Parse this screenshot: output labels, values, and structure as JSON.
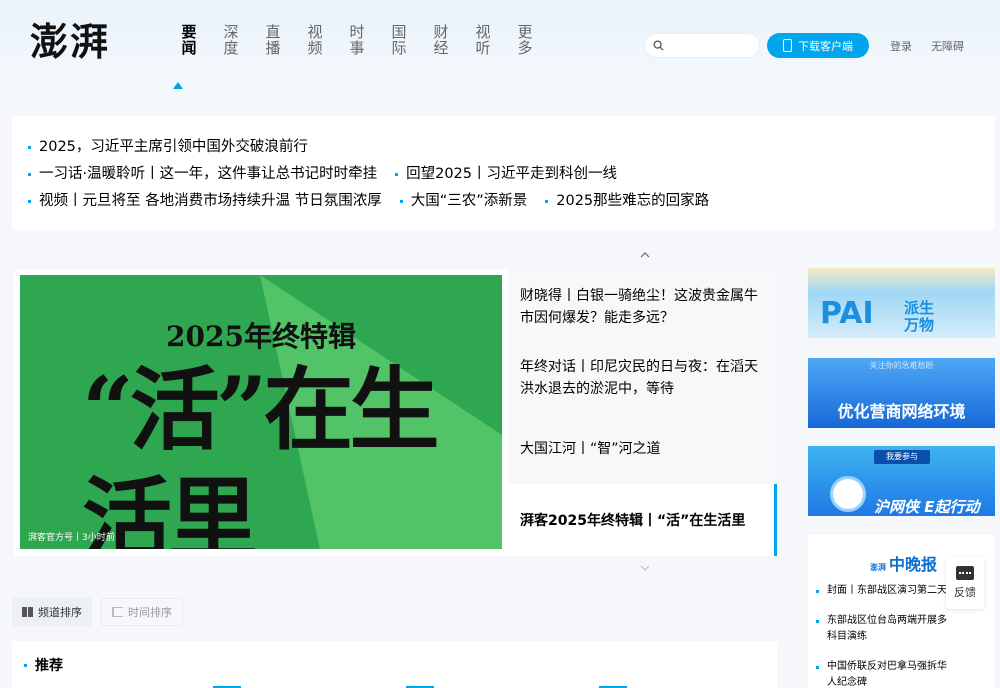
{
  "header": {
    "logo": "澎湃",
    "nav": [
      {
        "line1": "要",
        "line2": "闻"
      },
      {
        "line1": "深",
        "line2": "度"
      },
      {
        "line1": "直",
        "line2": "播"
      },
      {
        "line1": "视",
        "line2": "频"
      },
      {
        "line1": "时",
        "line2": "事"
      },
      {
        "line1": "国",
        "line2": "际"
      },
      {
        "line1": "财",
        "line2": "经"
      },
      {
        "line1": "视",
        "line2": "听"
      },
      {
        "line1": "更",
        "line2": "多"
      }
    ],
    "search_placeholder": "",
    "download_label": "下载客户端",
    "login_label": "登录",
    "accessibility_label": "无障碍"
  },
  "headlines": {
    "line1": [
      "2025，习近平主席引领中国外交破浪前行"
    ],
    "line2": [
      "一习话·温暖聆听丨这一年，这件事让总书记时时牵挂",
      "回望2025丨习近平走到科创一线"
    ],
    "line3": [
      "视频丨元旦将至 各地消费市场持续升温 节日氛围浓厚",
      "大国“三农”添新景",
      "2025那些难忘的回家路"
    ]
  },
  "focus": {
    "poster_sub": "2025年终特辑",
    "poster_main": "“活”在生活里",
    "poster_source": "湃客官方号丨3小时前",
    "items": [
      "财晓得丨白银一骑绝尘！这波贵金属牛市因何爆发？能走多远？",
      "年终对话丨印尼灾民的日与夜：在滔天洪水退去的淤泥中，等待",
      "大国江河丨“智”河之道",
      "湃客2025年终特辑丨“活”在生活里"
    ]
  },
  "ads": {
    "ad1_main": "PAI",
    "ad1_sub1": "派生",
    "ad1_sub2": "万物",
    "ad2_top": "关注你的急难愁盼",
    "ad2_main": "优化营商网络环境",
    "ad3_btn": "我要参与",
    "ad3_main": "沪网侠 E起行动"
  },
  "evening": {
    "logo_small": "澎湃",
    "logo": "中晚报",
    "items": [
      "封面丨东部战区演习第二天",
      "东部战区位台岛两端开展多科目演练",
      "中国侨联反对巴拿马强拆华人纪念碑"
    ]
  },
  "feedback_label": "反馈",
  "sort": {
    "by_channel": "频道排序",
    "by_time": "时间排序"
  },
  "recommend": {
    "title": "推荐"
  },
  "colors": {
    "accent": "#00a5eb",
    "poster_green": "#2fa750"
  }
}
